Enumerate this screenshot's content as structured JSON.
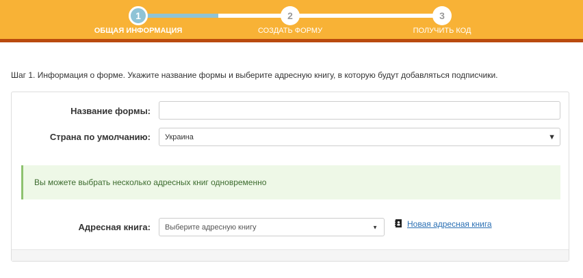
{
  "wizard": {
    "steps": [
      {
        "number": "1",
        "label": "ОБЩАЯ ИНФОРМАЦИЯ",
        "state": "active"
      },
      {
        "number": "2",
        "label": "СОЗДАТЬ ФОРМУ",
        "state": "inactive"
      },
      {
        "number": "3",
        "label": "ПОЛУЧИТЬ КОД",
        "state": "inactive"
      }
    ],
    "progress_fraction": 0.25,
    "colors": {
      "bar": "#f8b236",
      "bar_border": "#b94a0e",
      "active_step": "#8fc3d6"
    }
  },
  "intro": "Шаг 1. Информация о форме. Укажите название формы и выберите адресную книгу, в которую будут добавляться подписчики.",
  "form": {
    "name_label": "Название формы:",
    "name_value": "",
    "country_label": "Страна по умолчанию:",
    "country_value": "Украина",
    "info_message": "Вы можете выбрать несколько адресных книг одновременно",
    "book_label": "Адресная книга:",
    "book_placeholder": "Выберите адресную книгу",
    "new_book_link": "Новая адресная книга",
    "new_book_icon": "address-book-icon"
  }
}
